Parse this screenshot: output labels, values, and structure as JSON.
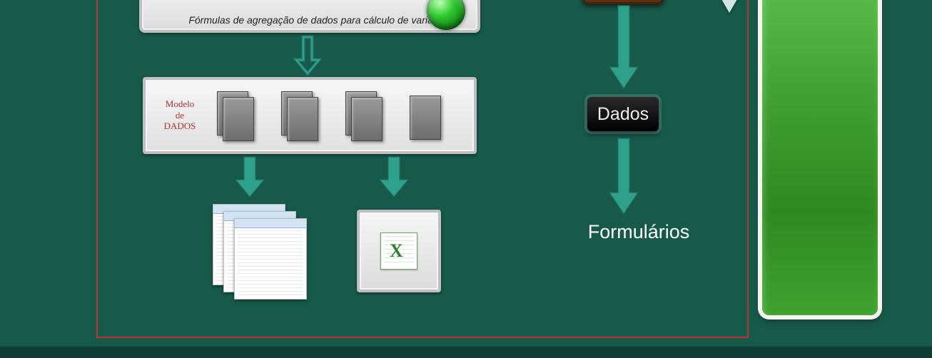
{
  "caption_formulas": "Fórmulas de agregação de dados para cálculo de variáveis",
  "model_label_line1": "Modelo",
  "model_label_line2": "de",
  "model_label_line3": "DADOS",
  "dados_label": "Dados",
  "formularios_label": "Formulários"
}
